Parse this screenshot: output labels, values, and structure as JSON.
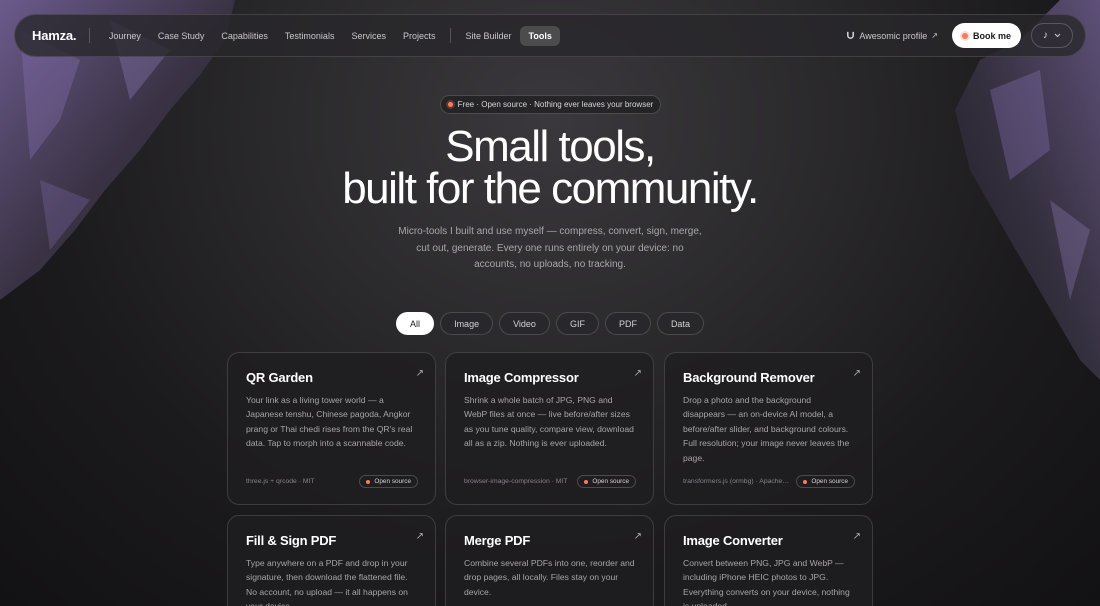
{
  "nav": {
    "brand": "Hamza.",
    "links": [
      "Journey",
      "Case Study",
      "Capabilities",
      "Testimonials",
      "Services",
      "Projects"
    ],
    "links2": [
      "Site Builder",
      "Tools"
    ],
    "active": "Tools",
    "profile_label": "Awesomic profile",
    "book_label": "Book me"
  },
  "hero": {
    "badge": "Free · Open source · Nothing ever leaves your browser",
    "title_line1": "Small tools,",
    "title_line2": "built for the community.",
    "subtitle": "Micro-tools I built and use myself — compress, convert, sign, merge, cut out, generate. Every one runs entirely on your device: no accounts, no uploads, no tracking."
  },
  "filters": [
    "All",
    "Image",
    "Video",
    "GIF",
    "PDF",
    "Data"
  ],
  "active_filter": "All",
  "cards": [
    {
      "title": "QR Garden",
      "desc": "Your link as a living tower world — a Japanese tenshu, Chinese pagoda, Angkor prang or Thai chedi rises from the QR's real data. Tap to morph into a scannable code.",
      "stack": "three.js + qrcode · MIT",
      "badge": "Open source"
    },
    {
      "title": "Image Compressor",
      "desc": "Shrink a whole batch of JPG, PNG and WebP files at once — live before/after sizes as you tune quality, compare view, download all as a zip. Nothing is ever uploaded.",
      "stack": "browser-image-compression · MIT",
      "badge": "Open source"
    },
    {
      "title": "Background Remover",
      "desc": "Drop a photo and the background disappears — an on-device AI model, a before/after slider, and background colours. Full resolution; your image never leaves the page.",
      "stack": "transformers.js (ormbg) · Apache-2.0",
      "badge": "Open source"
    },
    {
      "title": "Fill & Sign PDF",
      "desc": "Type anywhere on a PDF and drop in your signature, then download the flattened file. No account, no upload — it all happens on your device.",
      "stack": "",
      "badge": ""
    },
    {
      "title": "Merge PDF",
      "desc": "Combine several PDFs into one, reorder and drop pages, all locally. Files stay on your device.",
      "stack": "",
      "badge": ""
    },
    {
      "title": "Image Converter",
      "desc": "Convert between PNG, JPG and WebP — including iPhone HEIC photos to JPG. Everything converts on your device, nothing is uploaded.",
      "stack": "",
      "badge": ""
    }
  ],
  "colors": {
    "accent": "#ff7a5c",
    "rock": "#8a74b8"
  }
}
